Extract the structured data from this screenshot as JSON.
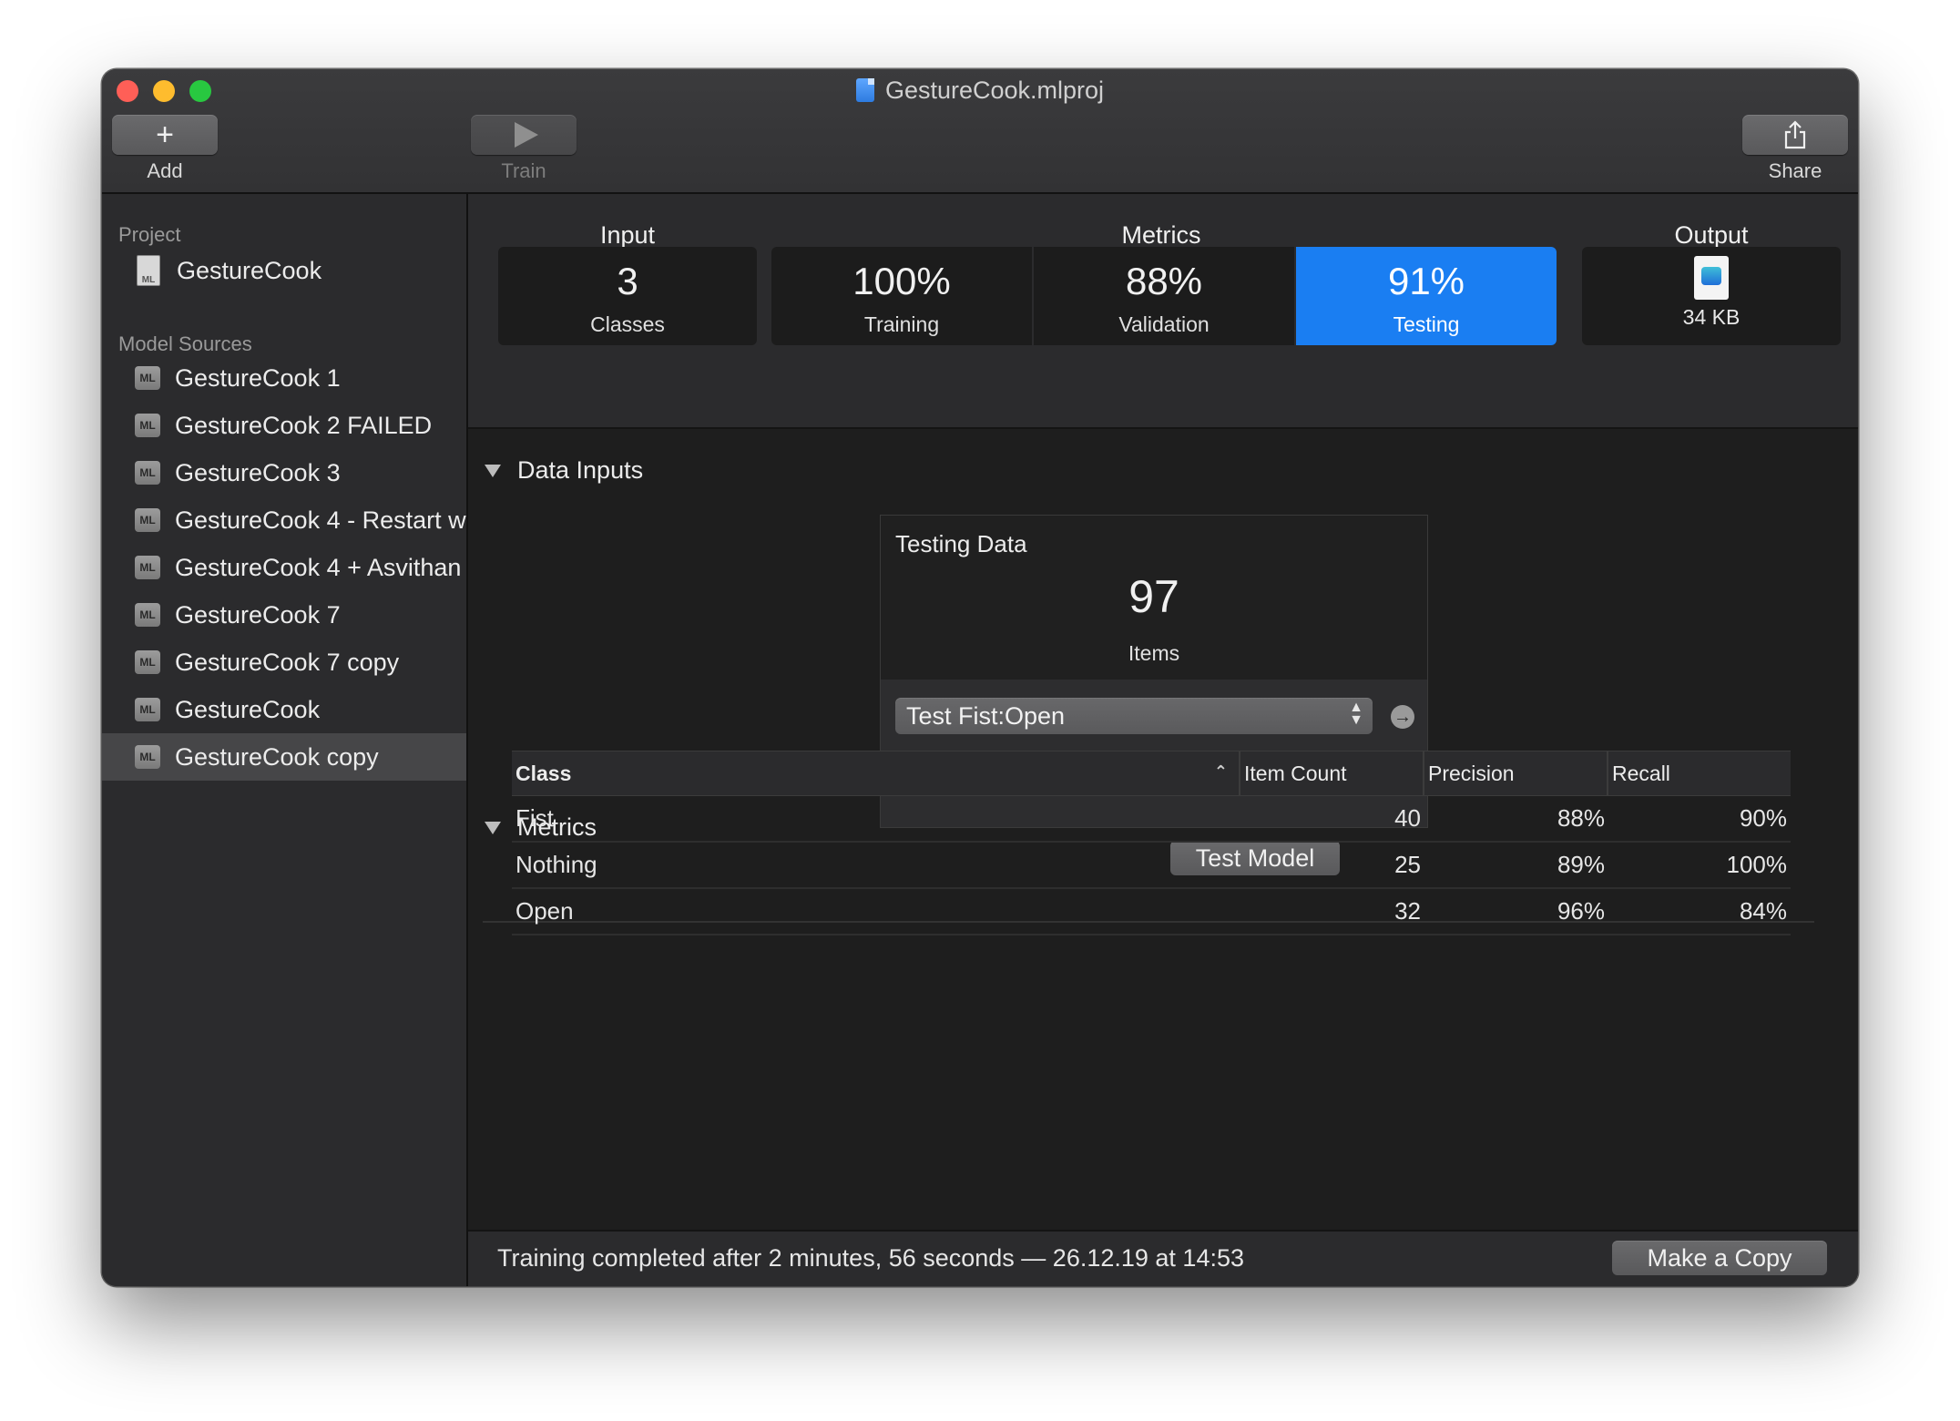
{
  "window": {
    "title": "GestureCook.mlproj"
  },
  "toolbar": {
    "add_label": "Add",
    "train_label": "Train",
    "share_label": "Share",
    "add_icon": "plus-icon",
    "train_icon": "play-icon",
    "share_icon": "share-icon"
  },
  "sidebar": {
    "project_header": "Project",
    "project_name": "GestureCook",
    "sources_header": "Model Sources",
    "items": [
      {
        "label": "GestureCook 1"
      },
      {
        "label": "GestureCook 2 FAILED"
      },
      {
        "label": "GestureCook 3"
      },
      {
        "label": "GestureCook 4 - Restart w"
      },
      {
        "label": "GestureCook 4 + Asvithan"
      },
      {
        "label": "GestureCook 7"
      },
      {
        "label": "GestureCook 7 copy"
      },
      {
        "label": "GestureCook"
      },
      {
        "label": "GestureCook copy",
        "selected": true
      }
    ]
  },
  "tabs": {
    "input_group": "Input",
    "metrics_group": "Metrics",
    "output_group": "Output",
    "classes": {
      "value": "3",
      "label": "Classes"
    },
    "training": {
      "value": "100%",
      "label": "Training"
    },
    "validation": {
      "value": "88%",
      "label": "Validation"
    },
    "testing": {
      "value": "91%",
      "label": "Testing",
      "active": true
    },
    "output": {
      "size": "34 KB",
      "icon": "mlmodel-file-icon"
    }
  },
  "data_inputs": {
    "section_title": "Data Inputs",
    "card_title": "Testing Data",
    "count": "97",
    "count_label": "Items",
    "selected_source": "Test Fist:Open",
    "test_button": "Test Model"
  },
  "metrics": {
    "section_title": "Metrics",
    "columns": [
      "Class",
      "Item Count",
      "Precision",
      "Recall"
    ],
    "rows": [
      {
        "class": "Fist",
        "count": "40",
        "precision": "88%",
        "recall": "90%"
      },
      {
        "class": "Nothing",
        "count": "25",
        "precision": "89%",
        "recall": "100%"
      },
      {
        "class": "Open",
        "count": "32",
        "precision": "96%",
        "recall": "84%"
      }
    ]
  },
  "status": {
    "text": "Training completed after 2 minutes, 56 seconds — 26.12.19 at 14:53",
    "copy_button": "Make a Copy"
  },
  "colors": {
    "accent": "#1a7ef2",
    "close": "#ff5f57",
    "minimize": "#febc2e",
    "maximize": "#28c840"
  }
}
